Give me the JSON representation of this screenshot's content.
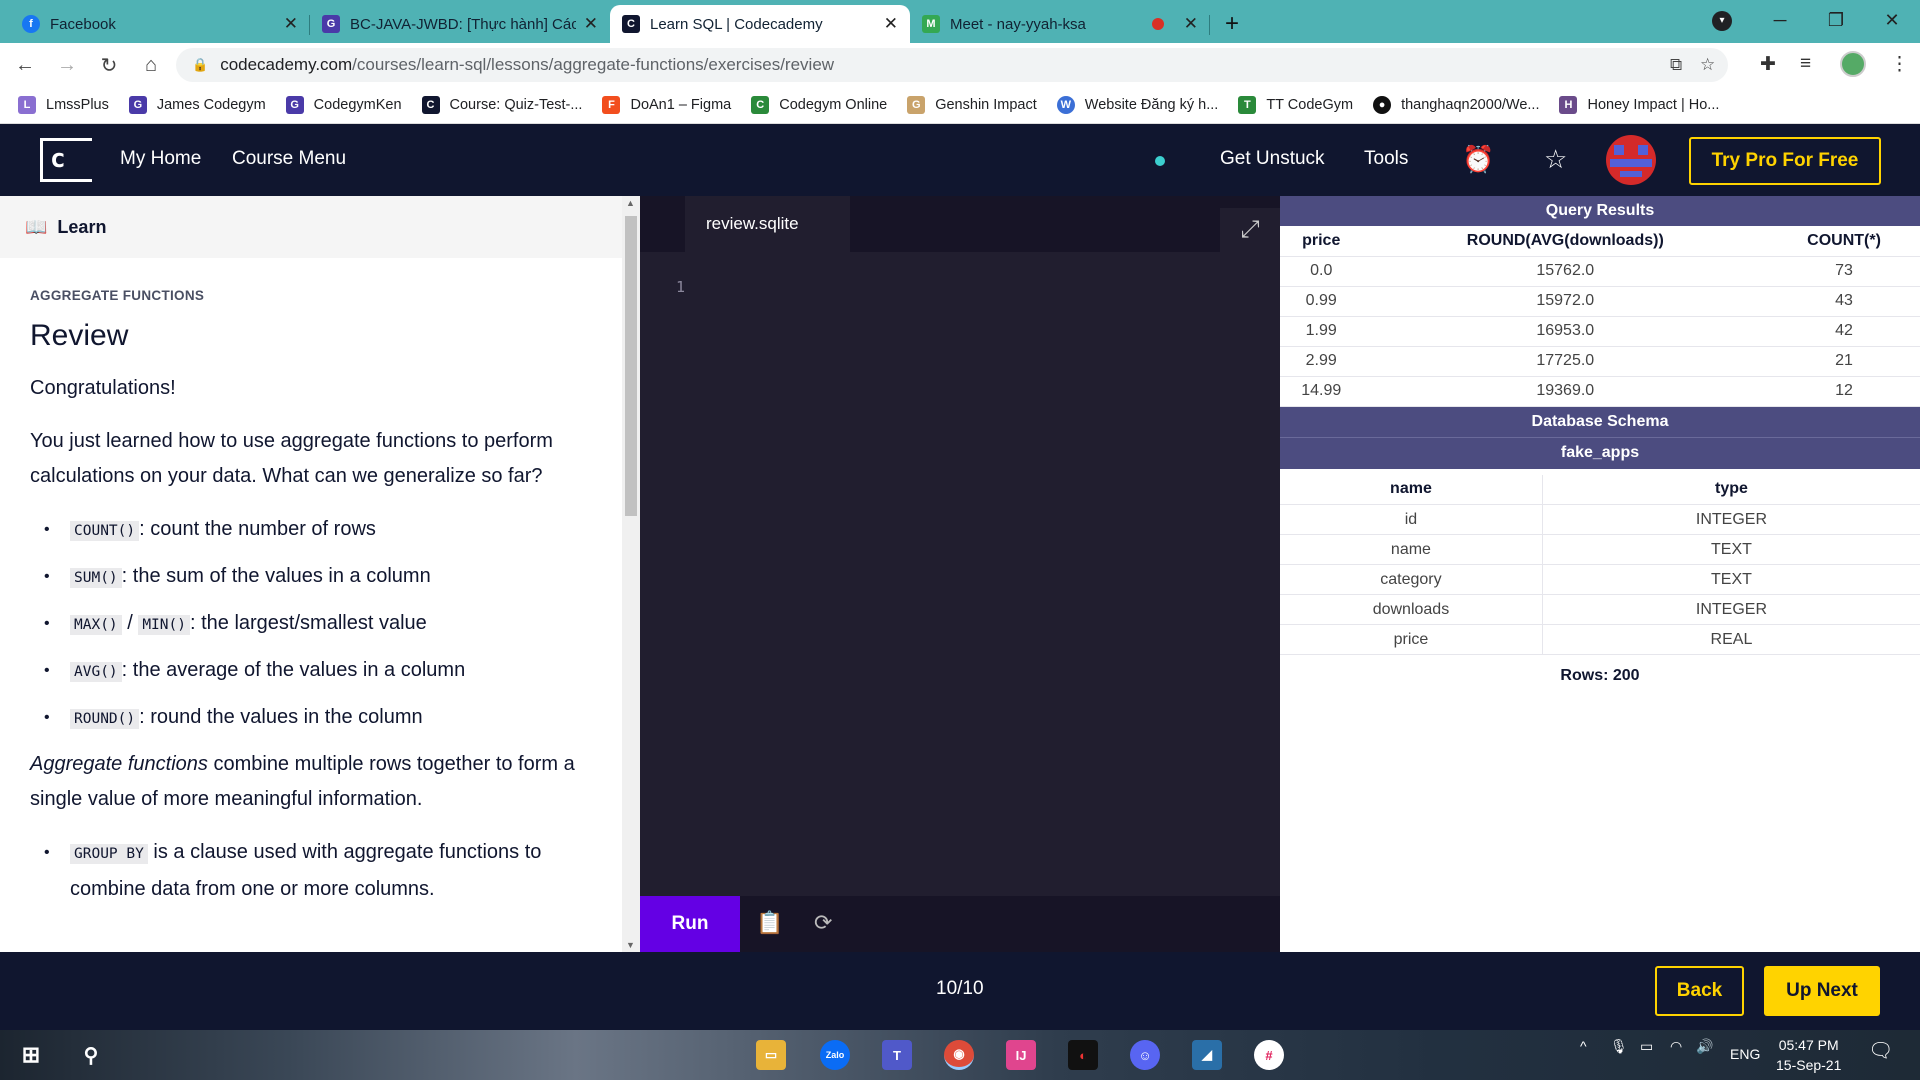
{
  "browser": {
    "tabs": [
      {
        "title": "Facebook",
        "color": "#1877f2"
      },
      {
        "title": "BC-JAVA-JWBD: [Thực hành] Các",
        "color": "#4a3aa8"
      },
      {
        "title": "Learn SQL | Codecademy",
        "color": "#10162f"
      },
      {
        "title": "Meet - nay-yyah-ksa",
        "color": "#34a853"
      }
    ],
    "url_host": "codecademy.com",
    "url_path": "/courses/learn-sql/lessons/aggregate-functions/exercises/review",
    "bookmarks": [
      "LmssPlus",
      "James Codegym",
      "CodegymKen",
      "Course: Quiz-Test-...",
      "DoAn1 – Figma",
      "Codegym Online",
      "Genshin Impact",
      "Website Đăng ký h...",
      "TT CodeGym",
      "thanghaqn2000/We...",
      "Honey Impact | Ho..."
    ]
  },
  "header": {
    "my_home": "My Home",
    "course_menu": "Course Menu",
    "get_unstuck": "Get Unstuck",
    "tools": "Tools",
    "try_pro": "Try Pro For Free"
  },
  "learn": {
    "tab": "Learn",
    "eyebrow": "AGGREGATE FUNCTIONS",
    "title": "Review",
    "congrats": "Congratulations!",
    "intro": "You just learned how to use aggregate functions to perform calculations on your data. What can we generalize so far?",
    "items": [
      {
        "code": "COUNT()",
        "text": ": count the number of rows"
      },
      {
        "code": "SUM()",
        "text": ": the sum of the values in a column"
      },
      {
        "code": "MAX()",
        "code2": "MIN()",
        "sep": " / ",
        "text": ": the largest/smallest value"
      },
      {
        "code": "AVG()",
        "text": ": the average of the values in a column"
      },
      {
        "code": "ROUND()",
        "text": ": round the values in the column"
      }
    ],
    "agg_em": "Aggregate functions",
    "agg_rest": " combine multiple rows together to form a single value of more meaningful information.",
    "group_code": "GROUP BY",
    "group_text": " is a clause used with aggregate functions to combine data from one or more columns."
  },
  "editor": {
    "filename": "review.sqlite",
    "line": "1",
    "run": "Run"
  },
  "results": {
    "title": "Query Results",
    "columns": [
      "price",
      "ROUND(AVG(downloads))",
      "COUNT(*)"
    ],
    "rows": [
      [
        "0.0",
        "15762.0",
        "73"
      ],
      [
        "0.99",
        "15972.0",
        "43"
      ],
      [
        "1.99",
        "16953.0",
        "42"
      ],
      [
        "2.99",
        "17725.0",
        "21"
      ],
      [
        "14.99",
        "19369.0",
        "12"
      ]
    ],
    "schema_title": "Database Schema",
    "table_name": "fake_apps",
    "schema_cols": [
      "name",
      "type"
    ],
    "schema_rows": [
      [
        "id",
        "INTEGER"
      ],
      [
        "name",
        "TEXT"
      ],
      [
        "category",
        "TEXT"
      ],
      [
        "downloads",
        "INTEGER"
      ],
      [
        "price",
        "REAL"
      ]
    ],
    "rows_count": "Rows: 200"
  },
  "footer": {
    "progress": "10/10",
    "back": "Back",
    "next": "Up Next"
  },
  "taskbar": {
    "lang": "ENG",
    "time": "05:47 PM",
    "date": "15-Sep-21"
  }
}
